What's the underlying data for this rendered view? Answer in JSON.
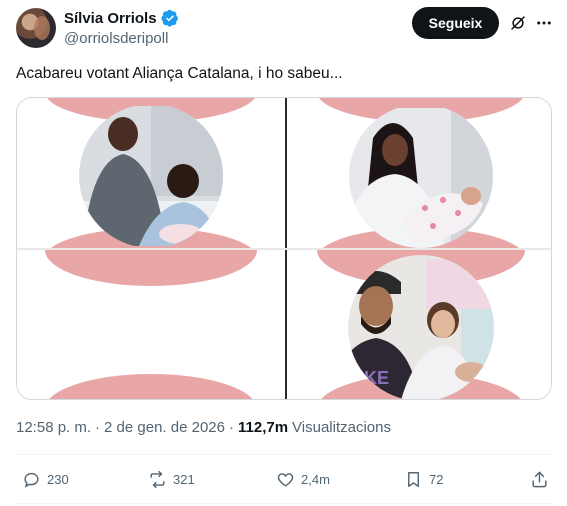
{
  "author": {
    "display_name": "Sílvia Orriols",
    "handle": "@orriolsderipoll",
    "verified": true
  },
  "header": {
    "follow_label": "Segueix",
    "grok_icon": "grok-icon",
    "more_icon": "more-icon"
  },
  "tweet": {
    "text": "Acabareu votant Aliança Catalana, i ho sabeu..."
  },
  "media": {
    "count": 4,
    "images": [
      {
        "description_icon": "photo",
        "position": "top-left"
      },
      {
        "description_icon": "photo",
        "position": "top-right"
      },
      {
        "description_icon": "photo",
        "position": "bottom-left"
      },
      {
        "description_icon": "photo",
        "position": "bottom-right"
      }
    ]
  },
  "meta": {
    "time": "12:58 p. m.",
    "separator": "·",
    "date": "2 de gen. de 2026",
    "views_count": "112,7m",
    "views_label": "Visualitzacions"
  },
  "actions": {
    "replies": "230",
    "reposts": "321",
    "likes": "2,4m",
    "bookmarks": "72"
  },
  "colors": {
    "follow_bg": "#0f1419",
    "verified": "#1d9bf0",
    "pink": "#e8a6a6",
    "muted": "#536471"
  }
}
